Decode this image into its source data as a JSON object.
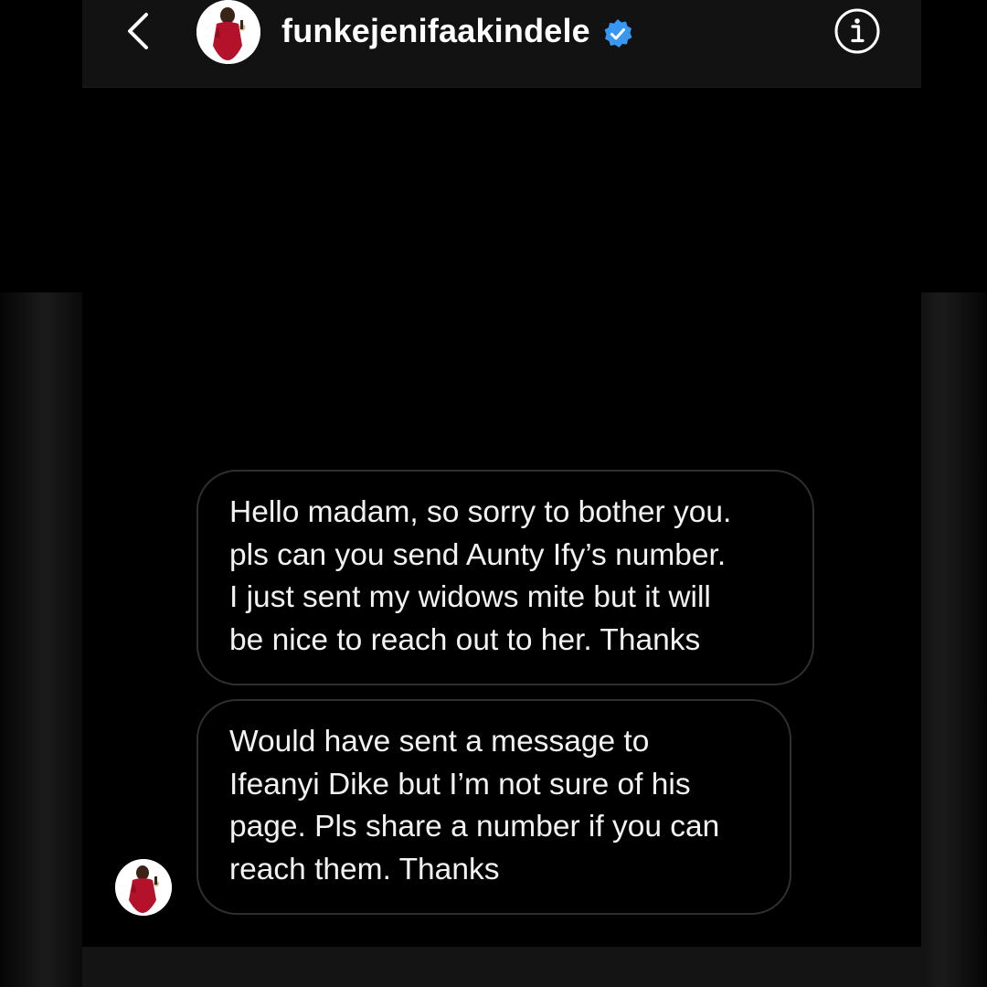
{
  "header": {
    "back_icon": "chevron-left-icon",
    "avatar_icon": "profile-photo",
    "username": "funkejenifaakindele",
    "verified_icon": "verified-badge-icon",
    "info_icon": "info-icon"
  },
  "messages": [
    {
      "text": "Hello madam, so sorry to bother you.\npls can you send Aunty Ify’s number.\nI just sent my widows mite but it will\nbe nice to reach out to her. Thanks"
    },
    {
      "text": "Would have sent a message to\nIfeanyi Dike but I’m not sure of his\npage. Pls share a number if you can\nreach them. Thanks"
    }
  ],
  "colors": {
    "background": "#000000",
    "header_background": "#121212",
    "bubble_border": "#2f2f2f",
    "text": "#f2f2f2",
    "verified_blue": "#3897f0"
  }
}
